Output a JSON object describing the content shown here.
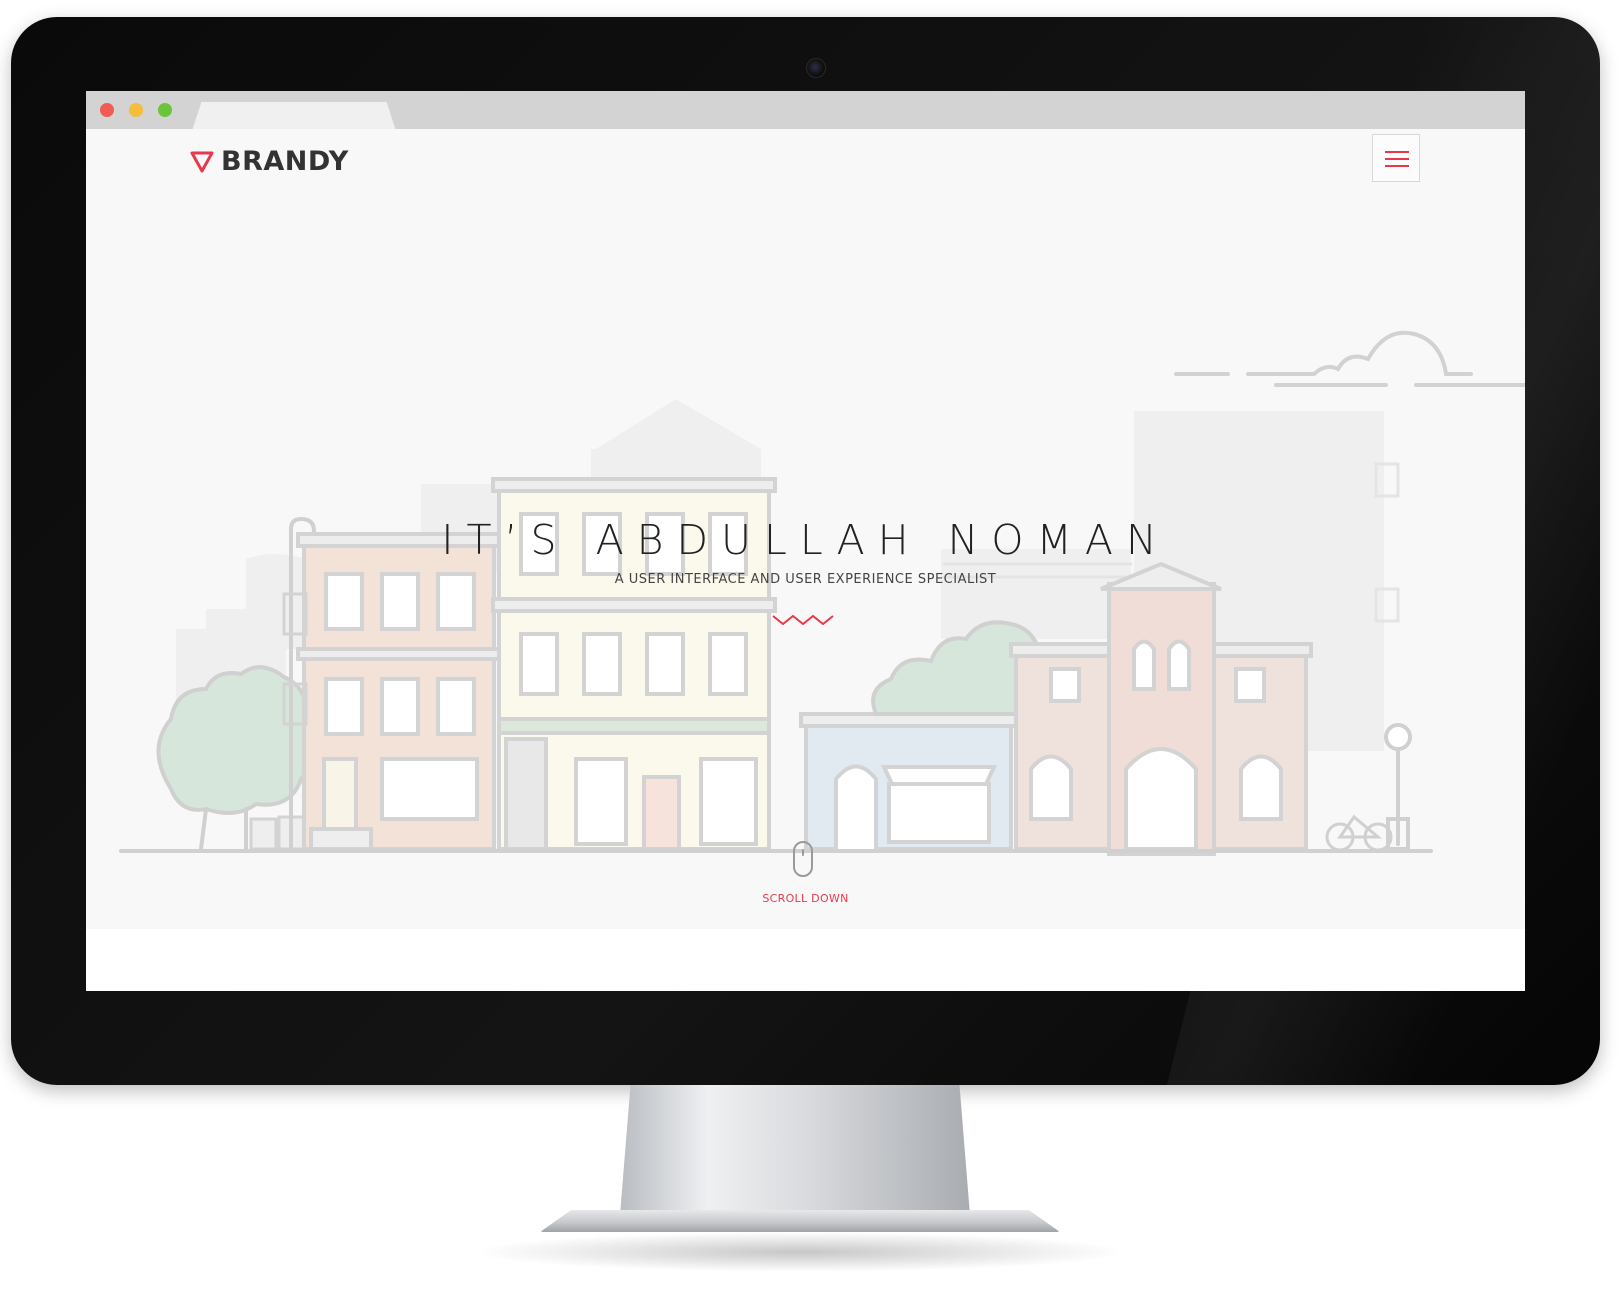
{
  "site": {
    "brand": "BRANDY",
    "hero_title": "IT’S ABDULLAH NOMAN",
    "hero_subtitle": "A USER INTERFACE AND USER EXPERIENCE SPECIALIST",
    "scroll_label": "SCROLL DOWN"
  },
  "icons": {
    "logo": "triangle-down-icon",
    "menu": "hamburger-menu-icon",
    "divider": "zigzag-icon",
    "scroll": "mouse-icon"
  },
  "colors": {
    "accent": "#e8394b",
    "text_dark": "#333333",
    "page_bg": "#f8f8f8",
    "monitor_bezel": "#0a0a0a"
  }
}
